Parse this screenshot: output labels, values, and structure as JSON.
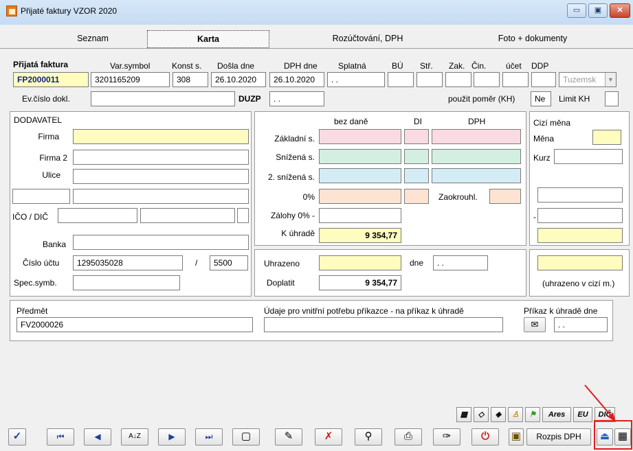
{
  "window": {
    "title": "Přijaté faktury VZOR 2020",
    "minimize_icon": "minimize-icon",
    "maximize_icon": "maximize-icon",
    "close_icon": "close-icon"
  },
  "tabs": [
    {
      "label": "Seznam"
    },
    {
      "label": "Karta"
    },
    {
      "label": "Rozúčtování, DPH"
    },
    {
      "label": "Foto + dokumenty"
    }
  ],
  "header": {
    "invoice_label": "Přijatá faktura",
    "invoice_number": "FP2000011",
    "varsymbol_label": "Var.symbol",
    "varsymbol": "3201165209",
    "konst_label": "Konst s.",
    "konst": "308",
    "dosla_label": "Došla dne",
    "dosla": "26.10.2020",
    "dph_dne_label": "DPH dne",
    "dph_dne": "26.10.2020",
    "splatna_label": "Splatná",
    "splatna": ". .",
    "bu_label": "BÚ",
    "str_label": "Stř.",
    "zak_label": "Zak.",
    "cin_label": "Čin.",
    "ucet_label": "účet",
    "ddp_label": "DDP",
    "ddp_value": "Tuzemsk",
    "evcislo_label": "Ev.číslo dokl.",
    "duzp_label": "DUZP",
    "duzp": ". .",
    "pouzit_label": "použit poměr (KH)",
    "pouzit_value": "Ne",
    "limit_label": "Limit KH"
  },
  "supplier": {
    "title": "DODAVATEL",
    "firma_label": "Firma",
    "firma2_label": "Firma 2",
    "ulice_label": "Ulice",
    "ico_label": "IČO / DIČ",
    "banka_label": "Banka",
    "cislo_uctu_label": "Číslo účtu",
    "cislo_uctu": "1295035028",
    "slash": "/",
    "bank_code": "5500",
    "spec_label": "Spec.symb."
  },
  "tax": {
    "col_bez_dane": "bez daně",
    "col_di": "DI",
    "col_dph": "DPH",
    "zakladni_label": "Základní s.",
    "snizena_label": "Snížená s.",
    "snizena2_label": "2. snížená s.",
    "zero_label": "0%",
    "zaokrouhl_label": "Zaokrouhl.",
    "zalohy_label": "Zálohy 0% -",
    "k_uhrade_label": "K úhradě",
    "k_uhrade": "9 354,77",
    "uhrazeno_label": "Uhrazeno",
    "dne_label": "dne",
    "dne_value": ". .",
    "doplatit_label": "Doplatit",
    "doplatit": "9 354,77"
  },
  "foreign": {
    "title": "Cizí měna",
    "mena_label": "Měna",
    "kurz_label": "Kurz",
    "dash": "-",
    "note": "(uhrazeno v cizí m.)"
  },
  "bottom": {
    "predmet_label": "Předmět",
    "predmet": "FV2000026",
    "udaje_label": "Údaje pro vnitřní potřebu příkazce - na příkaz k úhradě",
    "prikaz_label": "Příkaz k úhradě dne",
    "prikaz_date": ". ."
  },
  "icon_row": [
    {
      "icon": "qr-small-icon",
      "text": "▦"
    },
    {
      "icon": "czech-map-icon",
      "text": "◇"
    },
    {
      "icon": "czech-map-check-icon",
      "text": "◈"
    },
    {
      "icon": "person-icon",
      "text": "♙"
    },
    {
      "icon": "flag-icon",
      "text": "⚑"
    },
    {
      "icon": "ares-icon",
      "text": "Ares"
    },
    {
      "icon": "eu-icon",
      "text": "EU"
    },
    {
      "icon": "dic-icon",
      "text": "DIČ"
    }
  ],
  "toolbar": {
    "confirm": "✓",
    "first": "⏮",
    "prev": "◀",
    "sort": "A↓Z",
    "next": "▶",
    "last": "⏭",
    "new": "▢",
    "edit": "✎",
    "delete": "✗",
    "find": "⚲",
    "print": "⎙",
    "stamp": "✑",
    "power": "⏻",
    "calc": "▣",
    "rozpis_label": "Rozpis DPH",
    "scan": "⏏",
    "qr": "▦"
  },
  "colors": {
    "highlight": "#e01d1d",
    "invoice_number": "#0d1f8c"
  }
}
